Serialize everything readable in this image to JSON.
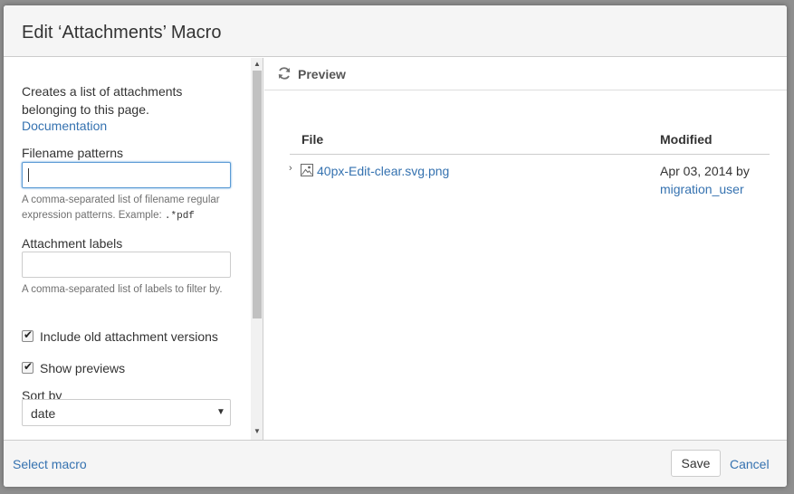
{
  "dialog": {
    "title": "Edit ‘Attachments’ Macro"
  },
  "left_panel": {
    "description": "Creates a list of attachments belonging to this page.",
    "documentation_link": "Documentation",
    "filename_patterns": {
      "label": "Filename patterns",
      "value": "",
      "help_text": "A comma-separated list of filename regular expression patterns. Example:",
      "help_example": ".*pdf"
    },
    "attachment_labels": {
      "label": "Attachment labels",
      "value": "",
      "help_text": "A comma-separated list of labels to filter by."
    },
    "include_old_versions": {
      "label": "Include old attachment versions",
      "checked": true
    },
    "show_previews": {
      "label": "Show previews",
      "checked": true
    },
    "sort_by": {
      "label": "Sort by",
      "selected": "date"
    }
  },
  "preview": {
    "title": "Preview",
    "columns": [
      "File",
      "Modified"
    ],
    "rows": [
      {
        "file": "40px-Edit-clear.svg.png",
        "modified_date": "Apr 03, 2014 by",
        "modified_user": "migration_user"
      }
    ]
  },
  "footer": {
    "select_macro": "Select macro",
    "save": "Save",
    "cancel": "Cancel"
  },
  "colors": {
    "link": "#3572b0",
    "header_bg": "#f5f5f5",
    "border": "#cccccc"
  }
}
